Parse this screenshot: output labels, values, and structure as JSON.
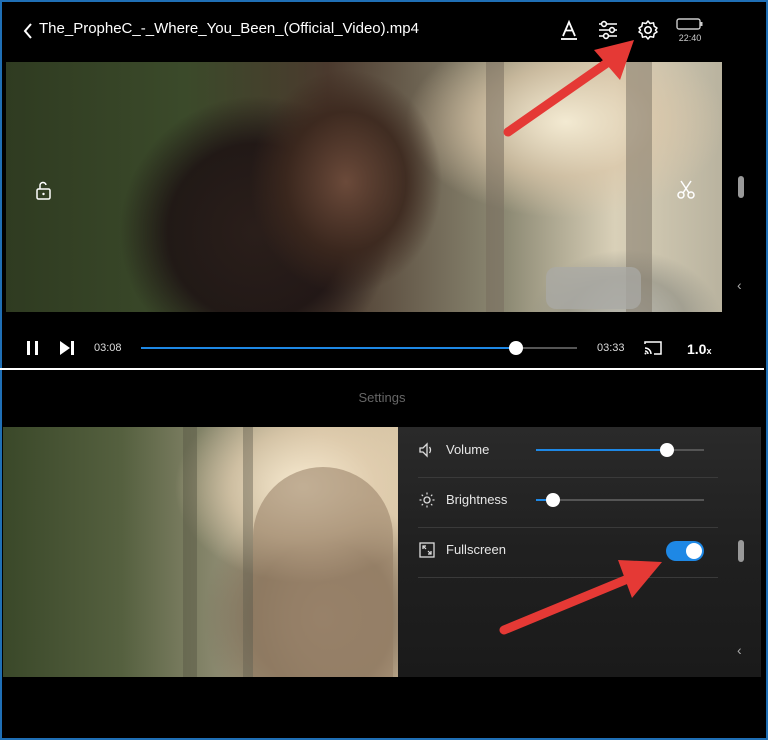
{
  "player": {
    "back_label": "<",
    "title": "The_PropheC_-_Where_You_Been_(Official_Video).mp4",
    "clock": "22:40",
    "current_time": "03:08",
    "total_time": "03:33",
    "progress": 0.86,
    "speed_value": "1.0",
    "speed_unit": "x"
  },
  "settings": {
    "title": "Settings",
    "rows": [
      {
        "label": "Volume",
        "icon": "speaker-icon",
        "value": 0.78
      },
      {
        "label": "Brightness",
        "icon": "sun-icon",
        "value": 0.1
      },
      {
        "label": "Fullscreen",
        "icon": "fullscreen-icon",
        "enabled": true
      }
    ]
  },
  "colors": {
    "accent": "#1e88e5",
    "annotation_arrow": "#e53935",
    "frame_border": "#1f6fb5"
  }
}
